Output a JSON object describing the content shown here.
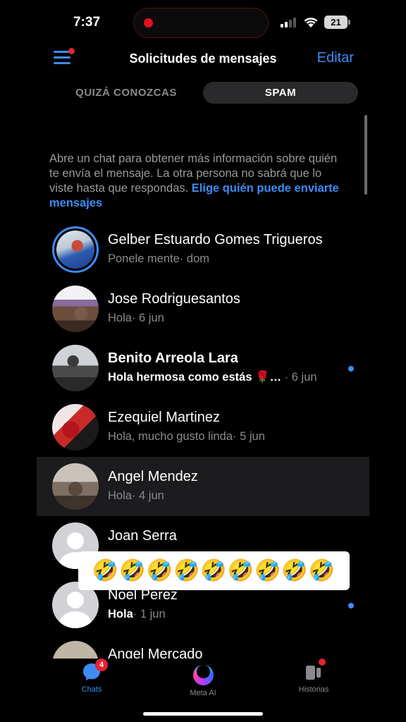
{
  "status_bar": {
    "time": "7:37",
    "battery": "21"
  },
  "header": {
    "title": "Solicitudes de mensajes",
    "edit_label": "Editar"
  },
  "tabs": [
    {
      "label": "QUIZÁ CONOZCAS",
      "active": false
    },
    {
      "label": "SPAM",
      "active": true
    }
  ],
  "info": {
    "text": "Abre un chat para obtener más información sobre quién te envía el mensaje. La otra persona no sabrá que lo viste hasta que respondas. ",
    "link": "Elige quién puede enviarte mensajes"
  },
  "chats": [
    {
      "name": "Gelber Estuardo Gomes Trigueros",
      "message": "Ponele mente",
      "time": "· dom",
      "unread": false
    },
    {
      "name": "Jose Rodriguesantos",
      "message": "Hola",
      "time": "· 6 jun",
      "unread": false
    },
    {
      "name": "Benito Arreola Lara",
      "message": "Hola hermosa como estás 🌹…",
      "time": " · 6 jun",
      "unread": true
    },
    {
      "name": "Ezequiel Martinez",
      "message": "Hola, mucho gusto linda",
      "time": "· 5 jun",
      "unread": false
    },
    {
      "name": "Angel Mendez",
      "message": "Hola",
      "time": "· 4 jun",
      "unread": false,
      "selected": true
    },
    {
      "name": "Joan Serra",
      "message": "",
      "time": "",
      "unread": false
    },
    {
      "name": "Noel Perez",
      "message": "Hola",
      "time": "· 1 jun",
      "unread": true
    },
    {
      "name": "Angel Mercado",
      "message": "",
      "time": "",
      "unread": false
    }
  ],
  "overlay": {
    "emojis": "🤣🤣🤣🤣🤣🤣🤣🤣🤣"
  },
  "bottom_nav": [
    {
      "label": "Chats",
      "icon": "chat-bubble-icon",
      "badge": "4",
      "active": true
    },
    {
      "label": "Meta AI",
      "icon": "meta-ai-ring-icon",
      "active": false
    },
    {
      "label": "Historias",
      "icon": "stories-icon",
      "active": false
    }
  ],
  "colors": {
    "accent": "#3d8cf5",
    "background": "#000000",
    "badge": "#e4232f"
  }
}
